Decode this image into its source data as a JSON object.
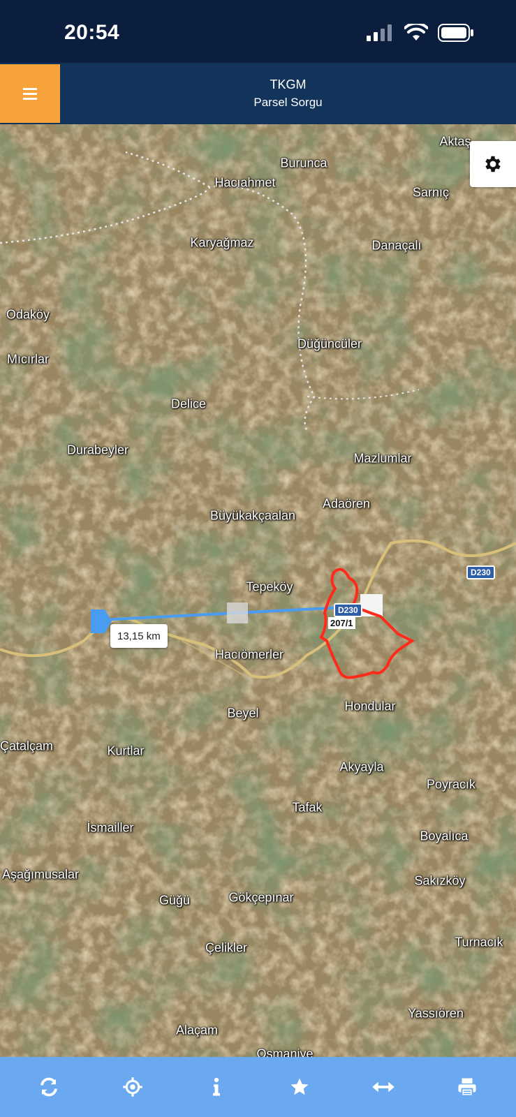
{
  "status_bar": {
    "time": "20:54",
    "icons": [
      "signal-icon",
      "wifi-icon",
      "battery-icon"
    ]
  },
  "header": {
    "menu_icon": "hamburger-menu-icon",
    "title": "TKGM",
    "subtitle": "Parsel Sorgu"
  },
  "map": {
    "settings_icon": "gear-icon",
    "measure_distance": "13,15 km",
    "parcel_label": "207/1",
    "road_shields": [
      "D230",
      "D230"
    ],
    "places": [
      "Aktaş",
      "Burunca",
      "Hacıahmet",
      "Sarnıç",
      "Karyağmaz",
      "Danaçalı",
      "Odaköy",
      "Mıcırlar",
      "Düğüncüler",
      "Delice",
      "Durabeyler",
      "Mazlumlar",
      "Adaören",
      "Büyükakçaalan",
      "Tepeköy",
      "Hacıömerler",
      "Hondular",
      "Beyel",
      "Çatalçam",
      "Kurtlar",
      "Akyayla",
      "Poyracık",
      "Tafak",
      "İsmailler",
      "Boyalıca",
      "Aşağımusalar",
      "Sakızköy",
      "Güğü",
      "Gökçepınar",
      "Turnacık",
      "Çelikler",
      "Yassıören",
      "Alaçam",
      "Osmaniye"
    ],
    "colors": {
      "parcel_outline": "#ff2a1a",
      "measure_line": "#4a9cf0",
      "road": "#d8c07a"
    }
  },
  "toolbar": {
    "buttons": [
      {
        "icon": "refresh-icon",
        "name": "refresh-button"
      },
      {
        "icon": "locate-icon",
        "name": "locate-button"
      },
      {
        "icon": "info-icon",
        "name": "info-button"
      },
      {
        "icon": "star-icon",
        "name": "favorite-button"
      },
      {
        "icon": "measure-icon",
        "name": "measure-button"
      },
      {
        "icon": "print-icon",
        "name": "print-button"
      }
    ]
  }
}
